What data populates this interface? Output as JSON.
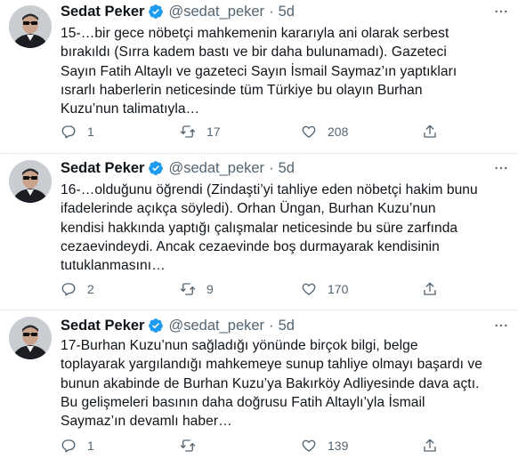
{
  "tweets": [
    {
      "name": "Sedat Peker",
      "handle": "@sedat_peker",
      "dot": "·",
      "time": "5d",
      "text": "15-…bir gece nöbetçi mahkemenin kararıyla ani olarak serbest\nbırakıldı (Sırra kadem bastı ve bir daha bulunamadı). Gazeteci\nSayın Fatih Altaylı ve gazeteci Sayın İsmail Saymaz’ın yaptıkları\nısrarlı haberlerin neticesinde tüm Türkiye bu olayın Burhan\nKuzu’nun talimatıyla…",
      "replies": "1",
      "retweets": "17",
      "likes": "208"
    },
    {
      "name": "Sedat Peker",
      "handle": "@sedat_peker",
      "dot": "·",
      "time": "5d",
      "text": "16-…olduğunu öğrendi (Zindaşti’yi tahliye eden nöbetçi hakim bunu\nifadelerinde açıkça söyledi). Orhan Üngan, Burhan Kuzu’nun\nkendisi hakkında yaptığı çalışmalar neticesinde bu süre zarfında\ncezaevindeydi. Ancak cezaevinde boş durmayarak kendisinin\ntutuklanmasını…",
      "replies": "2",
      "retweets": "9",
      "likes": "170"
    },
    {
      "name": "Sedat Peker",
      "handle": "@sedat_peker",
      "dot": "·",
      "time": "5d",
      "text": "17-Burhan Kuzu’nun sağladığı yönünde birçok bilgi, belge\ntoplayarak yargılandığı mahkemeye sunup tahliye olmayı başardı ve\nbunun akabinde de Burhan Kuzu’ya Bakırköy Adliyesinde dava açtı.\nBu gelişmeleri basının daha doğrusu Fatih Altaylı’yla İsmail\nSaymaz’ın devamlı haber…",
      "replies": "1",
      "retweets": "",
      "likes": "139"
    }
  ],
  "colors": {
    "verified": "#1d9bf0",
    "muted": "#536471",
    "text": "#0f1419",
    "divider": "#e6ecf0"
  },
  "icons": [
    "verified-badge-icon",
    "more-icon",
    "reply-icon",
    "retweet-icon",
    "like-icon",
    "share-icon"
  ]
}
